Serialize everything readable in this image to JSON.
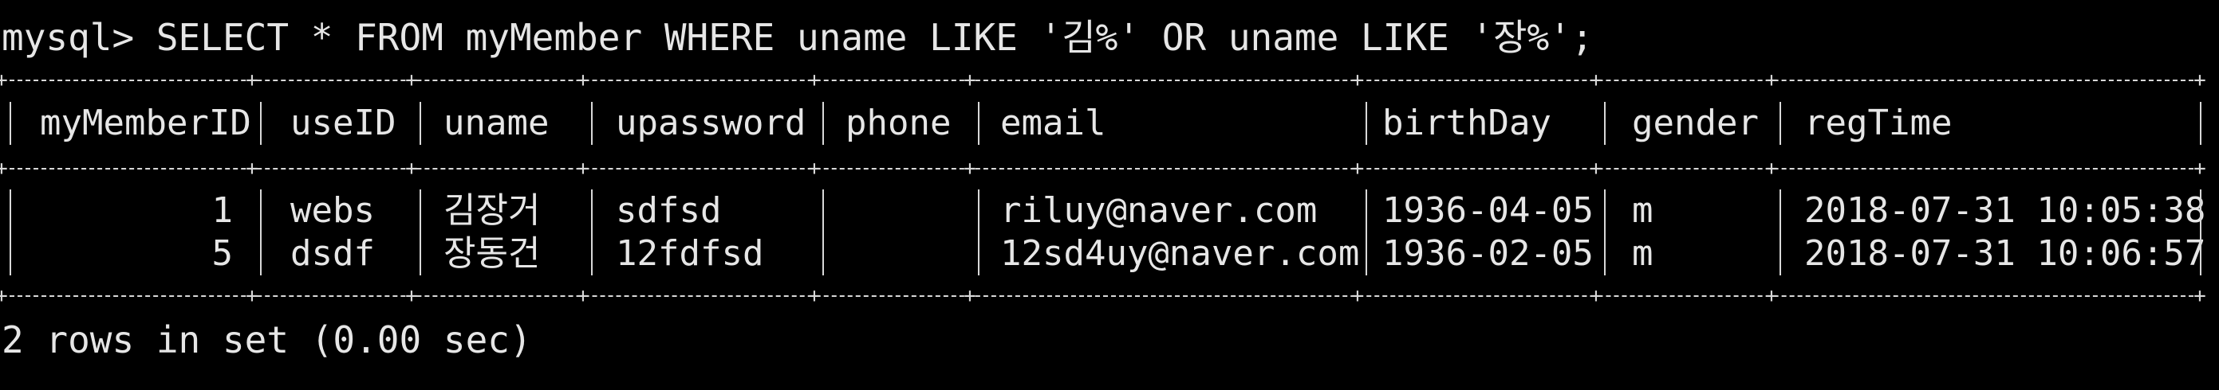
{
  "command": "mysql> SELECT * FROM myMember WHERE uname LIKE '김%' OR uname LIKE '장%';",
  "table": {
    "headers": [
      "myMemberID",
      "useID",
      "uname",
      "upassword",
      "phone",
      "email",
      "birthDay",
      "gender",
      "regTime"
    ],
    "rows": [
      [
        "1",
        "webs",
        "김장거",
        "sdfsd",
        "",
        "riluy@naver.com",
        "1936-04-05",
        "m",
        "2018-07-31 10:05:38"
      ],
      [
        "5",
        "dsdf",
        "장동건",
        "12fdfsd",
        "",
        "12sd4uy@naver.com",
        "1936-02-05",
        "m",
        "2018-07-31 10:06:57"
      ]
    ]
  },
  "footer": "2 rows in set (0.00 sec)",
  "colors": {
    "background": "#000000",
    "text": "#e6e6e6"
  }
}
